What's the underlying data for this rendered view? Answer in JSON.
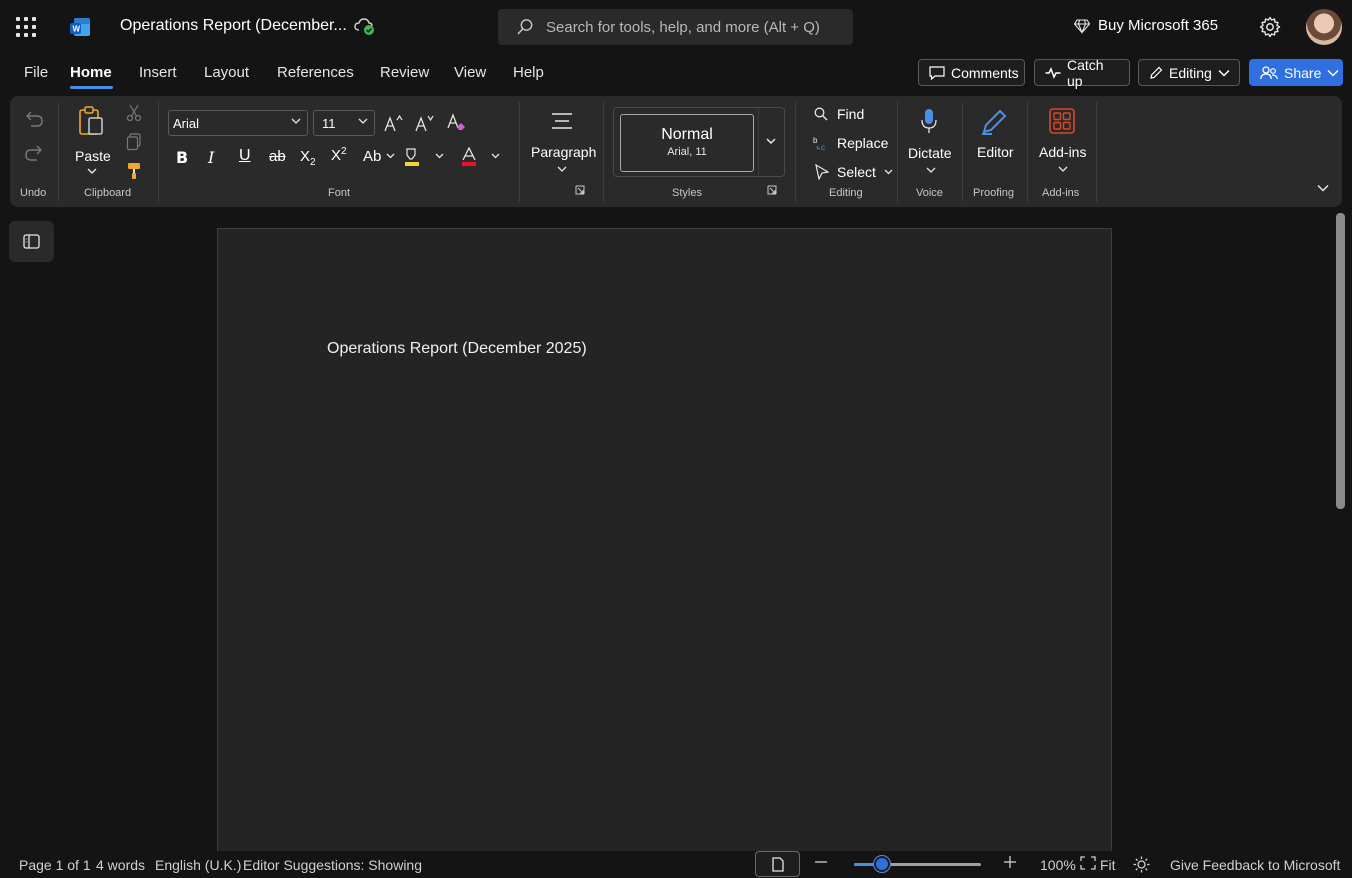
{
  "app": {
    "doc_title": "Operations Report (December...",
    "search_placeholder": "Search for tools, help, and more (Alt + Q)",
    "buy_label": "Buy Microsoft 365"
  },
  "menu": {
    "tabs": [
      "File",
      "Home",
      "Insert",
      "Layout",
      "References",
      "Review",
      "View",
      "Help"
    ],
    "active_tab": "Home",
    "comments": "Comments",
    "catch_up": "Catch up",
    "editing": "Editing",
    "share": "Share"
  },
  "ribbon": {
    "undo_group": "Undo",
    "paste": "Paste",
    "clipboard_group": "Clipboard",
    "font_name": "Arial",
    "font_size": "11",
    "font_group": "Font",
    "paragraph": "Paragraph",
    "style_name": "Normal",
    "style_font": "Arial, 11",
    "styles_group": "Styles",
    "find": "Find",
    "replace": "Replace",
    "select": "Select",
    "editing_group": "Editing",
    "dictate": "Dictate",
    "voice_group": "Voice",
    "editor": "Editor",
    "proofing_group": "Proofing",
    "addins": "Add-ins",
    "addins_group": "Add-ins",
    "colors": {
      "highlight": "#f5d33a",
      "font_color": "#e81123",
      "addins_icon": "#d9482b",
      "accent": "#2f6fe0"
    }
  },
  "document": {
    "heading": "Operations Report (December 2025)"
  },
  "status": {
    "page": "Page 1 of 1",
    "words": "4 words",
    "language": "English (U.K.)",
    "suggestions": "Editor Suggestions: Showing",
    "zoom": "100%",
    "zoom_level": 0.22,
    "fit": "Fit",
    "feedback": "Give Feedback to Microsoft"
  }
}
